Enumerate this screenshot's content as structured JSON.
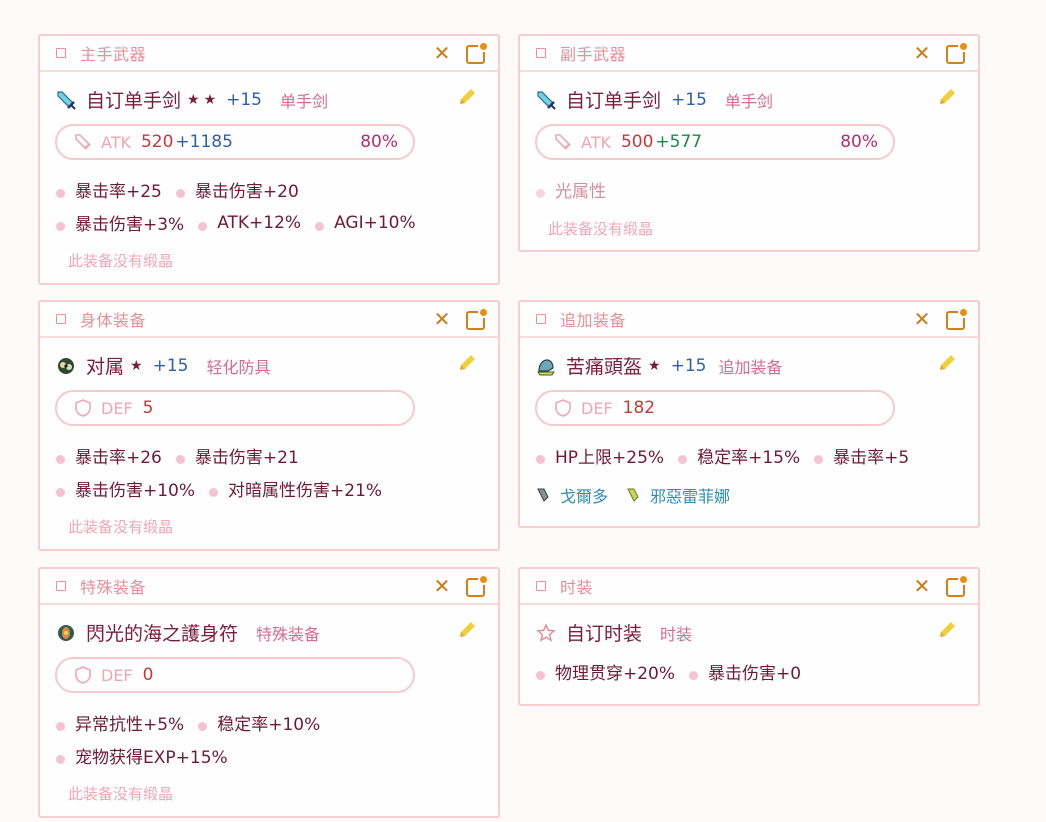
{
  "cards": {
    "main_weapon": {
      "title": "主手武器",
      "icon": "sword-icon",
      "name": "自订单手剑",
      "stars": "★★",
      "refine": "+15",
      "type": "单手剑",
      "stat": {
        "label": "ATK",
        "base": "520",
        "bonus": "+1185",
        "bonus_color": "#2f5faa",
        "pct": "80%"
      },
      "stats_line1": [
        "暴击率+25",
        "暴击伤害+20"
      ],
      "stats_line2": [
        "暴击伤害+3%",
        "ATK+12%",
        "AGI+10%"
      ],
      "no_crystal": "此装备没有缎晶"
    },
    "sub_weapon": {
      "title": "副手武器",
      "icon": "sword-icon",
      "name": "自订单手剑",
      "refine": "+15",
      "type": "单手剑",
      "stat": {
        "label": "ATK",
        "base": "500",
        "bonus": "+577",
        "bonus_color": "#1a8a4a",
        "pct": "80%"
      },
      "element": "光属性",
      "no_crystal": "此装备没有缎晶"
    },
    "body": {
      "title": "身体装备",
      "icon": "armor-icon",
      "name": "对属",
      "stars": "★",
      "refine": "+15",
      "type": "轻化防具",
      "stat": {
        "label": "DEF",
        "base": "5"
      },
      "stats_line1": [
        "暴击率+26",
        "暴击伤害+21"
      ],
      "stats_line2": [
        "暴击伤害+10%",
        "对暗属性伤害+21%"
      ],
      "no_crystal": "此装备没有缎晶"
    },
    "additional": {
      "title": "追加装备",
      "icon": "helmet-icon",
      "name": "苦痛頭盔",
      "stars": "★",
      "refine": "+15",
      "type": "追加装备",
      "stat": {
        "label": "DEF",
        "base": "182"
      },
      "stats_line1": [
        "HP上限+25%",
        "稳定率+15%",
        "暴击率+5"
      ],
      "crystals": [
        "戈爾多",
        "邪惡雷菲娜"
      ]
    },
    "special": {
      "title": "特殊装备",
      "icon": "amulet-icon",
      "name": "閃光的海之護身符",
      "type": "特殊装备",
      "stat": {
        "label": "DEF",
        "base": "0"
      },
      "stats_line1": [
        "异常抗性+5%",
        "稳定率+10%"
      ],
      "stats_line2": [
        "宠物获得EXP+15%"
      ],
      "no_crystal": "此装备没有缎晶"
    },
    "avatar": {
      "title": "时装",
      "icon": "star-outline-icon",
      "name": "自订时装",
      "type": "时装",
      "stats_line1": [
        "物理贯穿+20%",
        "暴击伤害+0"
      ]
    }
  },
  "colors": {
    "border": "#f7cdcd",
    "title": "#7a1c3c",
    "refine": "#2f5faa",
    "type": "#d46c90",
    "close": "#cc7a14",
    "edit": "#f2cf3c"
  }
}
